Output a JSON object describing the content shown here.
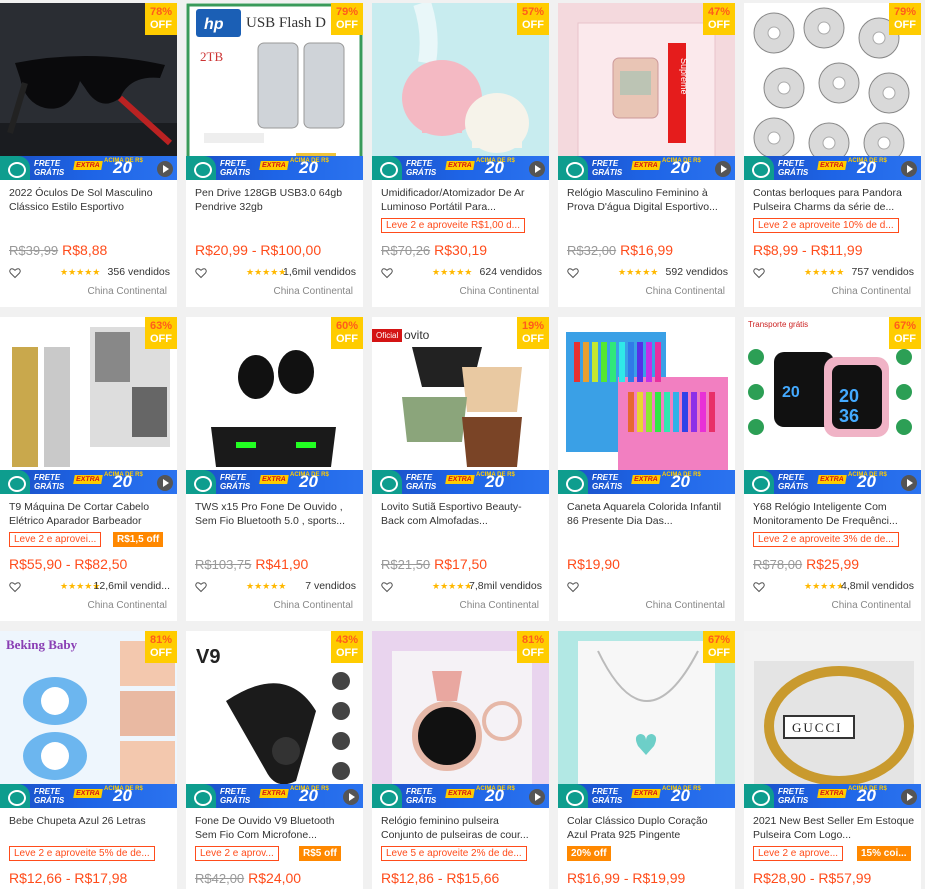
{
  "badge": {
    "off": "OFF",
    "frete_line1": "FRETE",
    "frete_line2": "GRÁTIS",
    "extra": "EXTRA",
    "acima": "ACIMA DE R$",
    "twenty": "20",
    "oficial": "Oficial"
  },
  "colors": {
    "price": "#ff4c1b",
    "badge": "#ffcc00",
    "frete": "#1e64e6",
    "stars": "#ffb800"
  },
  "products": [
    {
      "title": "2022 Óculos De Sol Masculino Clássico Estilo Esportivo",
      "discount": "78%",
      "old_price": "R$39,99",
      "price": "R$8,88",
      "price_max": "",
      "promo": "",
      "promo_badge": "",
      "stars": "★★★★★",
      "sold": "356 vendidos",
      "origin": "China Continental",
      "image": "sunglasses",
      "video": true
    },
    {
      "title": "Pen Drive 128GB USB3.0 64gb Pendrive 32gb",
      "discount": "79%",
      "old_price": "",
      "price": "R$20,99",
      "price_max": "R$100,00",
      "promo": "",
      "promo_badge": "",
      "stars": "★★★★★",
      "sold": "1,6mil vendidos",
      "origin": "China Continental",
      "image": "usb-flash-drive",
      "image_text": "USB Flash D",
      "video": false
    },
    {
      "title": "Umidificador/Atomizador De Ar Luminoso Portátil Para...",
      "discount": "57%",
      "old_price": "R$70,26",
      "price": "R$30,19",
      "price_max": "",
      "promo": "Leve 2 e aproveite R$1,00 d...",
      "promo_badge": "",
      "stars": "★★★★★",
      "sold": "624 vendidos",
      "origin": "China Continental",
      "image": "humidifier",
      "video": true
    },
    {
      "title": "Relógio Masculino Feminino à Prova D'água Digital Esportivo...",
      "discount": "47%",
      "old_price": "R$32,00",
      "price": "R$16,99",
      "price_max": "",
      "promo": "",
      "promo_badge": "",
      "stars": "★★★★★",
      "sold": "592 vendidos",
      "origin": "China Continental",
      "image": "digital-watch",
      "image_text": "Supreme",
      "video": true
    },
    {
      "title": "Contas berloques para Pandora Pulseira Charms da série de...",
      "discount": "79%",
      "old_price": "",
      "price": "R$8,99",
      "price_max": "R$11,99",
      "promo": "Leve 2 e aproveite 10% de d...",
      "promo_badge": "",
      "stars": "★★★★★",
      "sold": "757 vendidos",
      "origin": "China Continental",
      "image": "charms",
      "video": true
    },
    {
      "title": "T9 Máquina De Cortar Cabelo Elétrico Aparador Barbeador",
      "discount": "63%",
      "old_price": "",
      "price": "R$55,90",
      "price_max": "R$82,50",
      "promo": "Leve 2 e aprovei...",
      "promo_badge": "R$1,5 off",
      "stars": "★★★★★",
      "sold": "12,6mil vendid...",
      "origin": "China Continental",
      "image": "hair-clipper",
      "video": true
    },
    {
      "title": "TWS x15 Pro Fone De Ouvido , Sem Fio Bluetooth 5.0 , sports...",
      "discount": "60%",
      "old_price": "R$103,75",
      "price": "R$41,90",
      "price_max": "",
      "promo": "",
      "promo_badge": "",
      "stars": "★★★★★",
      "sold": "7 vendidos",
      "origin": "China Continental",
      "image": "earbuds",
      "video": false
    },
    {
      "title": "Lovito Sutiã Esportivo Beauty-Back com Almofadas...",
      "discount": "19%",
      "old_price": "R$21,50",
      "price": "R$17,50",
      "price_max": "",
      "promo": "",
      "promo_badge": "",
      "stars": "★★★★★",
      "sold": "7,8mil vendidos",
      "origin": "China Continental",
      "image": "sports-bras",
      "image_text": "ovito",
      "oficial": true,
      "video": false
    },
    {
      "title": "Caneta Aquarela Colorida Infantil 86 Presente Dia Das...",
      "discount": "",
      "old_price": "",
      "price": "R$19,90",
      "price_max": "",
      "promo": "",
      "promo_badge": "",
      "stars": "",
      "sold": "",
      "origin": "China Continental",
      "image": "art-set",
      "video": false
    },
    {
      "title": "Y68 Relógio Inteligente Com Monitoramento De Frequênci...",
      "discount": "67%",
      "old_price": "R$78,00",
      "price": "R$25,99",
      "price_max": "",
      "promo": "Leve 2 e aproveite 3% de de...",
      "promo_badge": "",
      "stars": "★★★★★",
      "sold": "4,8mil vendidos",
      "origin": "China Continental",
      "image": "smartwatch",
      "image_text": "Transporte grátis",
      "watch_time": "20 36",
      "video": true
    },
    {
      "title": "Bebe Chupeta Azul 26 Letras",
      "discount": "81%",
      "old_price": "",
      "price": "R$12,66",
      "price_max": "R$17,98",
      "promo": "Leve 2 e aproveite 5% de de...",
      "promo_badge": "",
      "stars": "",
      "sold": "",
      "origin": "",
      "image": "pacifier",
      "image_text": "Beking Baby",
      "video": false
    },
    {
      "title": "Fone De Ouvido V9 Bluetooth Sem Fio Com Microfone...",
      "discount": "43%",
      "old_price": "R$42,00",
      "price": "R$24,00",
      "price_max": "",
      "promo": "Leve 2 e aprov...",
      "promo_badge": "R$5 off",
      "stars": "",
      "sold": "",
      "origin": "",
      "image": "bluetooth-headset",
      "image_text": "V9",
      "video": true
    },
    {
      "title": "Relógio feminino pulseira Conjunto de pulseiras de cour...",
      "discount": "81%",
      "old_price": "",
      "price": "R$12,86",
      "price_max": "R$15,66",
      "promo": "Leve 5 e aproveite 2% de de...",
      "promo_badge": "",
      "stars": "",
      "sold": "",
      "origin": "",
      "image": "womens-watch",
      "video": true
    },
    {
      "title": "Colar Clássico Duplo Coração Azul Prata 925 Pingente",
      "discount": "67%",
      "old_price": "",
      "price": "R$16,99",
      "price_max": "R$19,99",
      "promo": "",
      "promo_badge": "20% off",
      "stars": "",
      "sold": "",
      "origin": "",
      "image": "necklace",
      "video": false
    },
    {
      "title": "2021 New Best Seller Em Estoque Pulseira Com Logo...",
      "discount": "",
      "old_price": "",
      "price": "R$28,90",
      "price_max": "R$57,99",
      "promo": "Leve 2 e aprove...",
      "promo_badge": "15% coi...",
      "stars": "",
      "sold": "",
      "origin": "",
      "image": "bracelet",
      "image_text": "GUCCI",
      "video": true
    }
  ]
}
